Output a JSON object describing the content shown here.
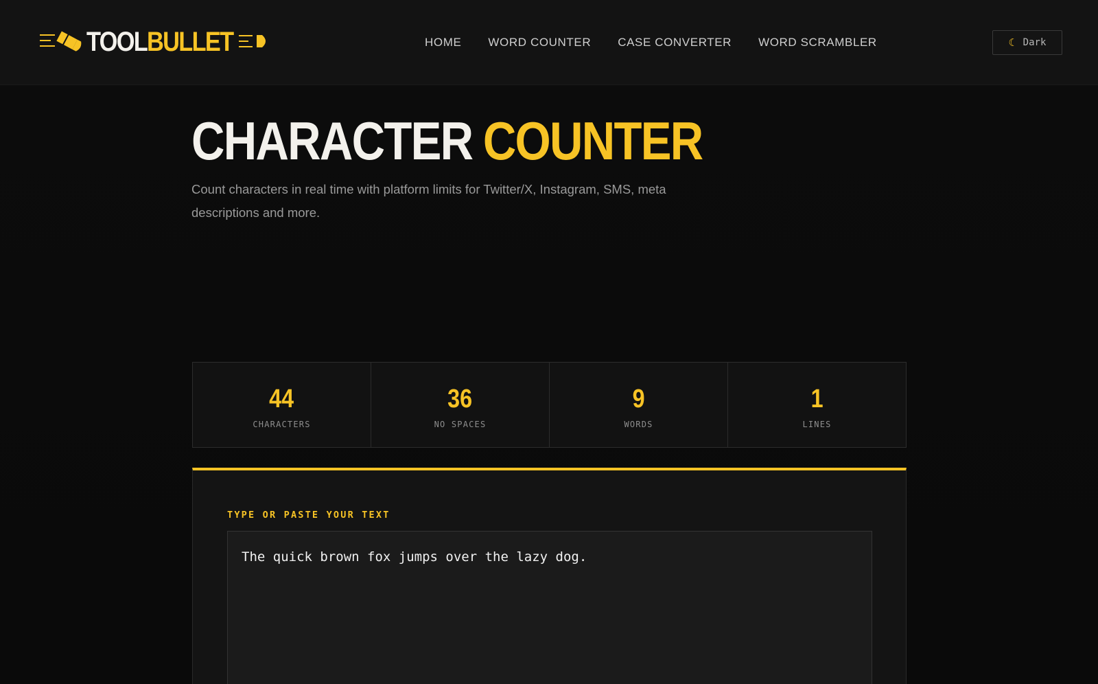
{
  "brand": {
    "part1": "TOOL",
    "part2": "BULLET",
    "accent": "#f7c325"
  },
  "nav": {
    "items": [
      {
        "label": "HOME"
      },
      {
        "label": "WORD COUNTER"
      },
      {
        "label": "CASE CONVERTER"
      },
      {
        "label": "WORD SCRAMBLER"
      }
    ]
  },
  "theme_toggle": {
    "icon": "moon-icon",
    "label": "Dark"
  },
  "hero": {
    "title_white": "CHARACTER",
    "title_accent": "COUNTER",
    "description": "Count characters in real time with platform limits for Twitter/X, Instagram, SMS, meta descriptions and more."
  },
  "stats": [
    {
      "value": "44",
      "label": "CHARACTERS"
    },
    {
      "value": "36",
      "label": "NO SPACES"
    },
    {
      "value": "9",
      "label": "WORDS"
    },
    {
      "value": "1",
      "label": "LINES"
    }
  ],
  "editor": {
    "label": "TYPE OR PASTE YOUR TEXT",
    "value": "The quick brown fox jumps over the lazy dog."
  }
}
